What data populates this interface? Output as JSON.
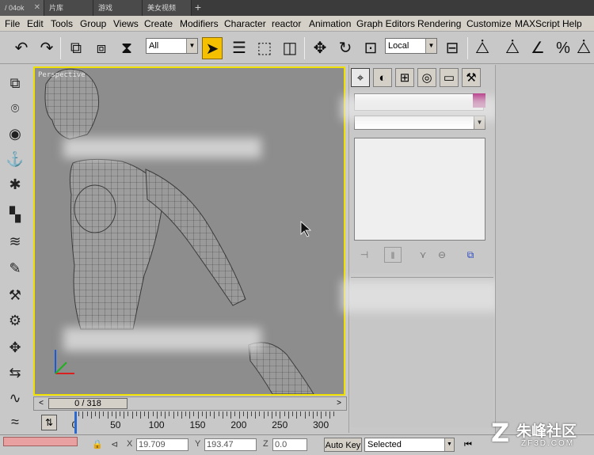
{
  "tabs": [
    {
      "label": "/ 04ok",
      "active": true
    },
    {
      "label": "片库"
    },
    {
      "label": "游戏"
    },
    {
      "label": "美女视频"
    }
  ],
  "tab_new_label": "+",
  "menu": [
    "File",
    "Edit",
    "Tools",
    "Group",
    "Views",
    "Create",
    "Modifiers",
    "Character",
    "reactor",
    "Animation",
    "Graph Editors",
    "Rendering",
    "Customize",
    "MAXScript",
    "Help"
  ],
  "toolbar": {
    "selection_filter": "All",
    "reference_coord": "Local",
    "icons": {
      "undo": "↶",
      "redo": "↷",
      "link": "⧉",
      "unlink": "⧈",
      "bind": "⧗",
      "select": "➤",
      "select_by_name": "☰",
      "rect_region": "⬚",
      "window": "◫",
      "move": "✥",
      "rotate": "↻",
      "pivot": "⊡",
      "mirror": "⊟",
      "snap": "⧊",
      "angle": "∠",
      "percent": "%"
    }
  },
  "left_tools": [
    "⧉",
    "⌾",
    "◉",
    "⚓",
    "✱",
    "▚",
    "≋",
    "✎",
    "⚒",
    "⚙",
    "✥",
    "⇆",
    "∿",
    "≈"
  ],
  "viewport": {
    "label": "Perspective",
    "accent": "#f0e000",
    "background": "#8d8d8d"
  },
  "command_panel": {
    "tabs": [
      "⌖",
      "◐",
      "⊞",
      "◎",
      "▭",
      "⚒"
    ],
    "swatch": "#b0207a",
    "stack_buttons": [
      "⊣",
      "‖",
      "⋎",
      "⊖",
      "⧉"
    ]
  },
  "time_slider": {
    "position": "0 / 318",
    "left_arrow": "<",
    "right_arrow": ">"
  },
  "trackbar": {
    "start": 0,
    "visible_end": 318,
    "labels": [
      "0",
      "50",
      "100",
      "150",
      "200",
      "250",
      "300"
    ]
  },
  "status": {
    "x": "19.709",
    "y": "193.47",
    "z": "0.0",
    "x_label": "X",
    "y_label": "Y",
    "z_label": "Z",
    "autokey": "Auto Key",
    "selected": "Selected",
    "prev_key_icon": "⏮"
  },
  "watermark": {
    "logo": "Z",
    "text": "朱峰社区",
    "domain": "ZF3D.COM"
  }
}
